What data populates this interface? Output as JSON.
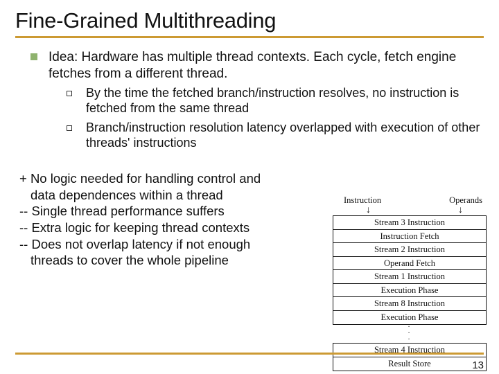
{
  "title": "Fine-Grained Multithreading",
  "idea": "Idea: Hardware has multiple thread contexts. Each cycle, fetch engine fetches from a different thread.",
  "sub1": "By the time the fetched branch/instruction resolves, no instruction is fetched from the same thread",
  "sub2": "Branch/instruction resolution latency overlapped with execution of other threads' instructions",
  "pc1a": "+ No logic needed for handling control and",
  "pc1b": "data dependences within a thread",
  "pc2": "-- Single thread performance suffers",
  "pc3": "-- Extra logic for keeping thread contexts",
  "pc4a": "-- Does not overlap latency if not enough",
  "pc4b": "threads to cover the whole pipeline",
  "page": "13",
  "diagram": {
    "labelL": "Instruction",
    "labelR": "Operands",
    "s1": "Stream 3 Instruction",
    "s2": "Instruction Fetch",
    "s3": "Stream 2 Instruction",
    "s4": "Operand Fetch",
    "s5": "Stream 1 Instruction",
    "s6": "Execution Phase",
    "s7": "Stream 8 Instruction",
    "s8": "Execution Phase",
    "s9": "Stream 4 Instruction",
    "s10": "Result Store"
  }
}
